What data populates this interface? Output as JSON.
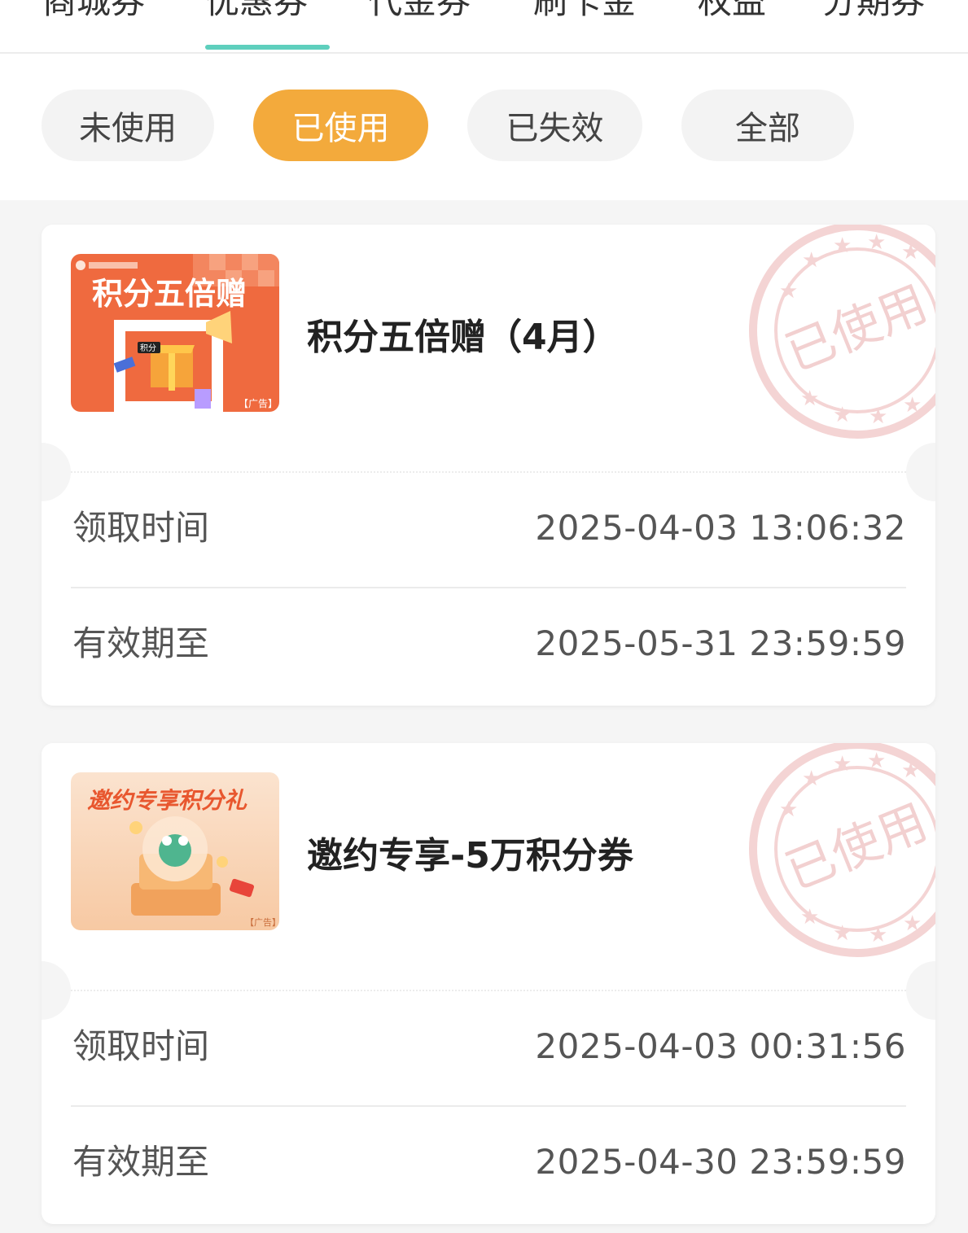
{
  "colors": {
    "accent_teal": "#5ecfbd",
    "active_pill": "#f3aa3c",
    "stamp_red": "#e88a8a"
  },
  "tabs": [
    {
      "label": "商城券"
    },
    {
      "label": "优惠券"
    },
    {
      "label": "代金券"
    },
    {
      "label": "刷卡金"
    },
    {
      "label": "权益"
    },
    {
      "label": "分期券"
    }
  ],
  "filters": [
    {
      "label": "未使用"
    },
    {
      "label": "已使用"
    },
    {
      "label": "已失效"
    },
    {
      "label": "全部"
    }
  ],
  "coupons": [
    {
      "title": "积分五倍赠（4月）",
      "thumb_heading": "积分五倍赠",
      "thumb_badge": "积分",
      "thumb_ad": "【广告】",
      "stamp_text": "已使用",
      "received_label": "领取时间",
      "received_value": "2025-04-03 13:06:32",
      "expiry_label": "有效期至",
      "expiry_value": "2025-05-31 23:59:59"
    },
    {
      "title": "邀约专享-5万积分券",
      "thumb_heading": "邀约专享积分礼",
      "thumb_ad": "【广告】",
      "stamp_text": "已使用",
      "received_label": "领取时间",
      "received_value": "2025-04-03 00:31:56",
      "expiry_label": "有效期至",
      "expiry_value": "2025-04-30 23:59:59"
    }
  ]
}
